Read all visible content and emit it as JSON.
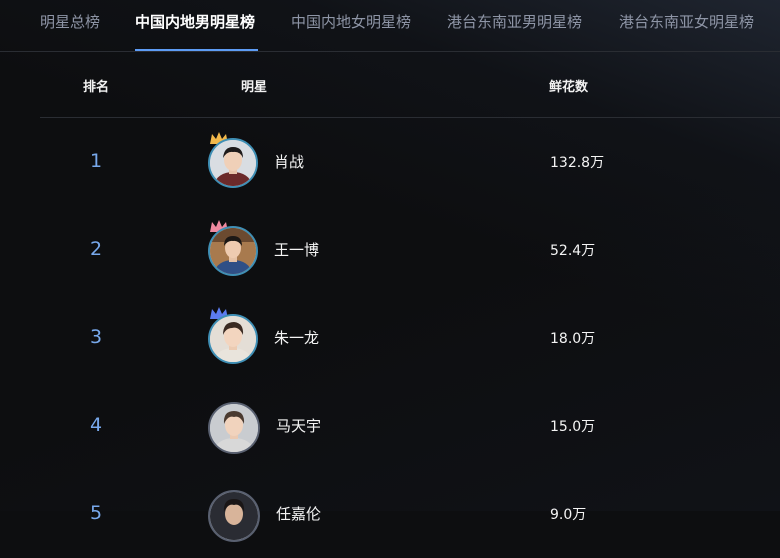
{
  "tabs": [
    {
      "label": "明星总榜"
    },
    {
      "label": "中国内地男明星榜",
      "active": true
    },
    {
      "label": "中国内地女明星榜"
    },
    {
      "label": "港台东南亚男明星榜"
    },
    {
      "label": "港台东南亚女明星榜"
    }
  ],
  "table": {
    "headers": {
      "rank": "排名",
      "star": "明星",
      "flowers": "鲜花数"
    },
    "rows": [
      {
        "rank": "1",
        "name": "肖战",
        "flowers": "132.8万",
        "crown": "gold"
      },
      {
        "rank": "2",
        "name": "王一博",
        "flowers": "52.4万",
        "crown": "pink"
      },
      {
        "rank": "3",
        "name": "朱一龙",
        "flowers": "18.0万",
        "crown": "blue"
      },
      {
        "rank": "4",
        "name": "马天宇",
        "flowers": "15.0万",
        "crown": ""
      },
      {
        "rank": "5",
        "name": "任嘉伦",
        "flowers": "9.0万",
        "crown": ""
      }
    ]
  },
  "colors": {
    "accent": "#5d9cf5",
    "rank_text": "#78a9ec",
    "crown_gold": "#f2b84b",
    "crown_pink": "#f08aa0",
    "crown_blue": "#5b7cf0"
  }
}
